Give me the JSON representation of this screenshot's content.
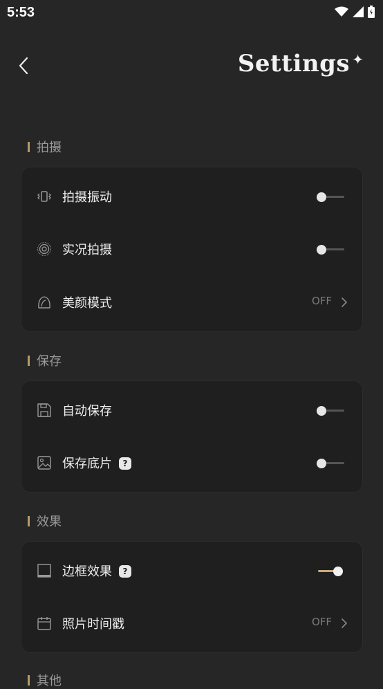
{
  "status_bar": {
    "time": "5:53"
  },
  "header": {
    "title": "Settings",
    "sparkle": "✦"
  },
  "sections": [
    {
      "label": "拍摄",
      "rows": [
        {
          "icon": "vibrate-icon",
          "label": "拍摄振动",
          "control": "toggle",
          "on": false
        },
        {
          "icon": "live-photo-icon",
          "label": "实况拍摄",
          "control": "toggle",
          "on": false
        },
        {
          "icon": "beauty-face-icon",
          "label": "美颜模式",
          "control": "value",
          "value": "OFF"
        }
      ]
    },
    {
      "label": "保存",
      "rows": [
        {
          "icon": "save-icon",
          "label": "自动保存",
          "control": "toggle",
          "on": false
        },
        {
          "icon": "image-icon",
          "label": "保存底片",
          "help": "?",
          "control": "toggle",
          "on": false
        }
      ]
    },
    {
      "label": "效果",
      "rows": [
        {
          "icon": "frame-icon",
          "label": "边框效果",
          "help": "?",
          "control": "toggle",
          "on": true
        },
        {
          "icon": "calendar-icon",
          "label": "照片时间戳",
          "control": "value",
          "value": "OFF"
        }
      ]
    },
    {
      "label": "其他",
      "rows": []
    }
  ],
  "colors": {
    "accent": "#c9a979",
    "background": "#262626",
    "card": "#1f1f1f"
  }
}
